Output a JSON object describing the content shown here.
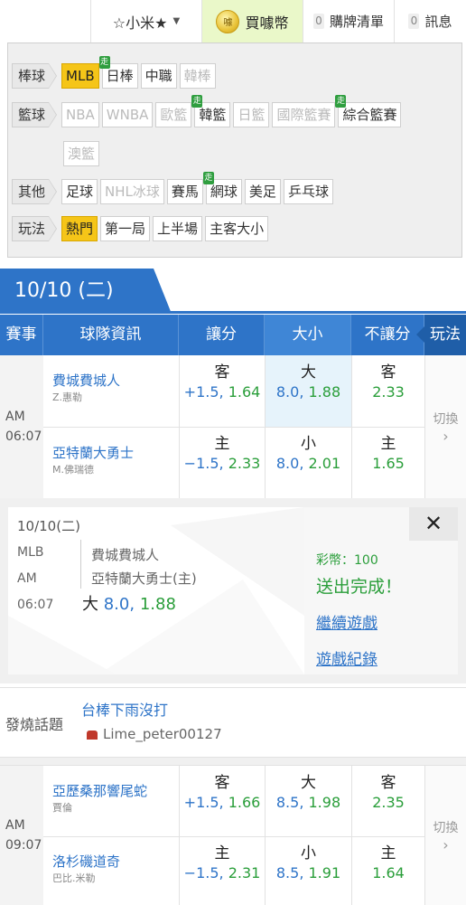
{
  "topbar": {
    "user": "☆小米★",
    "buy_label": "買噱幣",
    "coin_text": "噱",
    "cart": {
      "count": "0",
      "label": "購牌清單"
    },
    "msg": {
      "count": "0",
      "label": "訊息"
    }
  },
  "filter": {
    "baseball": {
      "label": "棒球",
      "items": [
        "MLB",
        "日棒",
        "中職",
        "韓棒"
      ]
    },
    "basketball": {
      "label": "籃球",
      "items": [
        "NBA",
        "WNBA",
        "歐籃",
        "韓籃",
        "日籃",
        "國際籃賽",
        "綜合籃賽",
        "澳籃"
      ]
    },
    "other": {
      "label": "其他",
      "items": [
        "足球",
        "NHL冰球",
        "賽馬",
        "網球",
        "美足",
        "乒乓球"
      ]
    },
    "play": {
      "label": "玩法",
      "items": [
        "熱門",
        "第一局",
        "上半場",
        "主客大小"
      ]
    },
    "live_badge": "走"
  },
  "date_tab": "10/10 (二)",
  "header": {
    "event": "賽事",
    "team": "球隊資訊",
    "spread": "讓分",
    "ou": "大小",
    "ml": "不讓分",
    "play": "玩法"
  },
  "games": [
    {
      "ampm": "AM",
      "time": "06:07",
      "away": {
        "name": "費城費城人",
        "pitcher": "Z.惠勒"
      },
      "home": {
        "name": "亞特蘭大勇士",
        "pitcher": "M.佛瑞德"
      },
      "away_spread": {
        "label": "客",
        "line": "+1.5",
        "odds": "1.64"
      },
      "home_spread": {
        "label": "主",
        "line": "−1.5",
        "odds": "2.33"
      },
      "over": {
        "label": "大",
        "line": "8.0",
        "odds": "1.88"
      },
      "under": {
        "label": "小",
        "line": "8.0",
        "odds": "2.01"
      },
      "away_ml": {
        "label": "客",
        "odds": "2.33"
      },
      "home_ml": {
        "label": "主",
        "odds": "1.65"
      },
      "switch": "切換"
    },
    {
      "ampm": "AM",
      "time": "09:07",
      "away": {
        "name": "亞歷桑那響尾蛇",
        "pitcher": "賈倫"
      },
      "home": {
        "name": "洛杉磯道奇",
        "pitcher": "巴比.米勒"
      },
      "away_spread": {
        "label": "客",
        "line": "+1.5",
        "odds": "1.66"
      },
      "home_spread": {
        "label": "主",
        "line": "−1.5",
        "odds": "2.31"
      },
      "over": {
        "label": "大",
        "line": "8.5",
        "odds": "1.98"
      },
      "under": {
        "label": "小",
        "line": "8.5",
        "odds": "1.91"
      },
      "away_ml": {
        "label": "客",
        "odds": "2.35"
      },
      "home_ml": {
        "label": "主",
        "odds": "1.64"
      },
      "switch": "切換"
    }
  ],
  "popup": {
    "date": "10/10(二)",
    "league": "MLB",
    "ampm": "AM",
    "time": "06:07",
    "team1": "費城費城人",
    "team2": "亞特蘭大勇士(主)",
    "pick_label": "大",
    "pick_line": "8.0",
    "pick_odds": "1.88",
    "coins": "彩幣：100",
    "sent": "送出完成！",
    "continue": "繼續遊戲",
    "record": "遊戲紀錄",
    "close": "✕"
  },
  "hot_topic": {
    "label": "發燒話題",
    "title": "台棒下雨沒打",
    "author": "Lime_peter00127"
  },
  "colors": {
    "blue": "#2e74c8",
    "green": "#2a9e3a",
    "red": "#e0322b",
    "highlight": "#f5c518"
  }
}
